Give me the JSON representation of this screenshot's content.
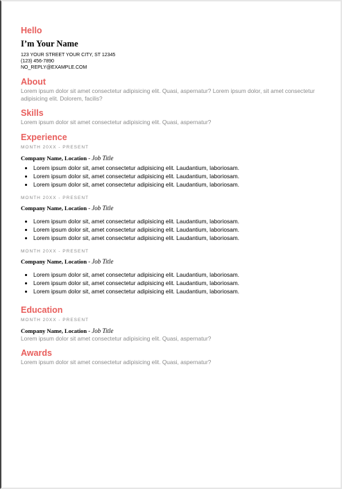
{
  "hello": "Hello",
  "name": "I’m Your Name",
  "contact": {
    "address": "123 YOUR STREET YOUR CITY, ST 12345",
    "phone": "(123) 456-7890",
    "email": "NO_REPLY@EXAMPLE.COM"
  },
  "about": {
    "heading": "About",
    "text": "Lorem ipsum dolor sit amet consectetur adipisicing elit. Quasi, aspernatur? Lorem ipsum dolor, sit amet consectetur adipisicing elit. Dolorem, facilis?"
  },
  "skills": {
    "heading": "Skills",
    "text": "Lorem ipsum dolor sit amet consectetur adipisicing elit. Quasi, aspernatur?"
  },
  "experience": {
    "heading": "Experience",
    "jobs": [
      {
        "date": "MONTH 20XX - PRESENT",
        "company": "Company Name, Location - ",
        "title": "Job Title",
        "bullets": [
          "Lorem ipsum dolor sit, amet consectetur adipisicing elit. Laudantium, laboriosam.",
          "Lorem ipsum dolor sit, amet consectetur adipisicing elit. Laudantium, laboriosam.",
          "Lorem ipsum dolor sit, amet consectetur adipisicing elit. Laudantium, laboriosam."
        ]
      },
      {
        "date": "MONTH 20XX - PRESENT",
        "company": "Company Name, Location - ",
        "title": "Job Title",
        "bullets": [
          "Lorem ipsum dolor sit, amet consectetur adipisicing elit. Laudantium, laboriosam.",
          "Lorem ipsum dolor sit, amet consectetur adipisicing elit. Laudantium, laboriosam.",
          "Lorem ipsum dolor sit, amet consectetur adipisicing elit. Laudantium, laboriosam."
        ]
      },
      {
        "date": "MONTH 20XX - PRESENT",
        "company": "Company Name, Location - ",
        "title": "Job Title",
        "bullets": [
          "Lorem ipsum dolor sit, amet consectetur adipisicing elit. Laudantium, laboriosam.",
          "Lorem ipsum dolor sit, amet consectetur adipisicing elit. Laudantium, laboriosam.",
          "Lorem ipsum dolor sit, amet consectetur adipisicing elit. Laudantium, laboriosam."
        ]
      }
    ]
  },
  "education": {
    "heading": "Education",
    "date": "MONTH 20XX - PRESENT",
    "company": "Company Name, Location - ",
    "title": "Job Title",
    "text": "Lorem ipsum dolor sit amet consectetur adipisicing elit. Quasi, aspernatur?"
  },
  "awards": {
    "heading": "Awards",
    "text": "Lorem ipsum dolor sit amet consectetur adipisicing elit. Quasi, aspernatur?"
  },
  "colors": {
    "accent": "#e85e5c",
    "muted_text": "#8a8a8a"
  }
}
